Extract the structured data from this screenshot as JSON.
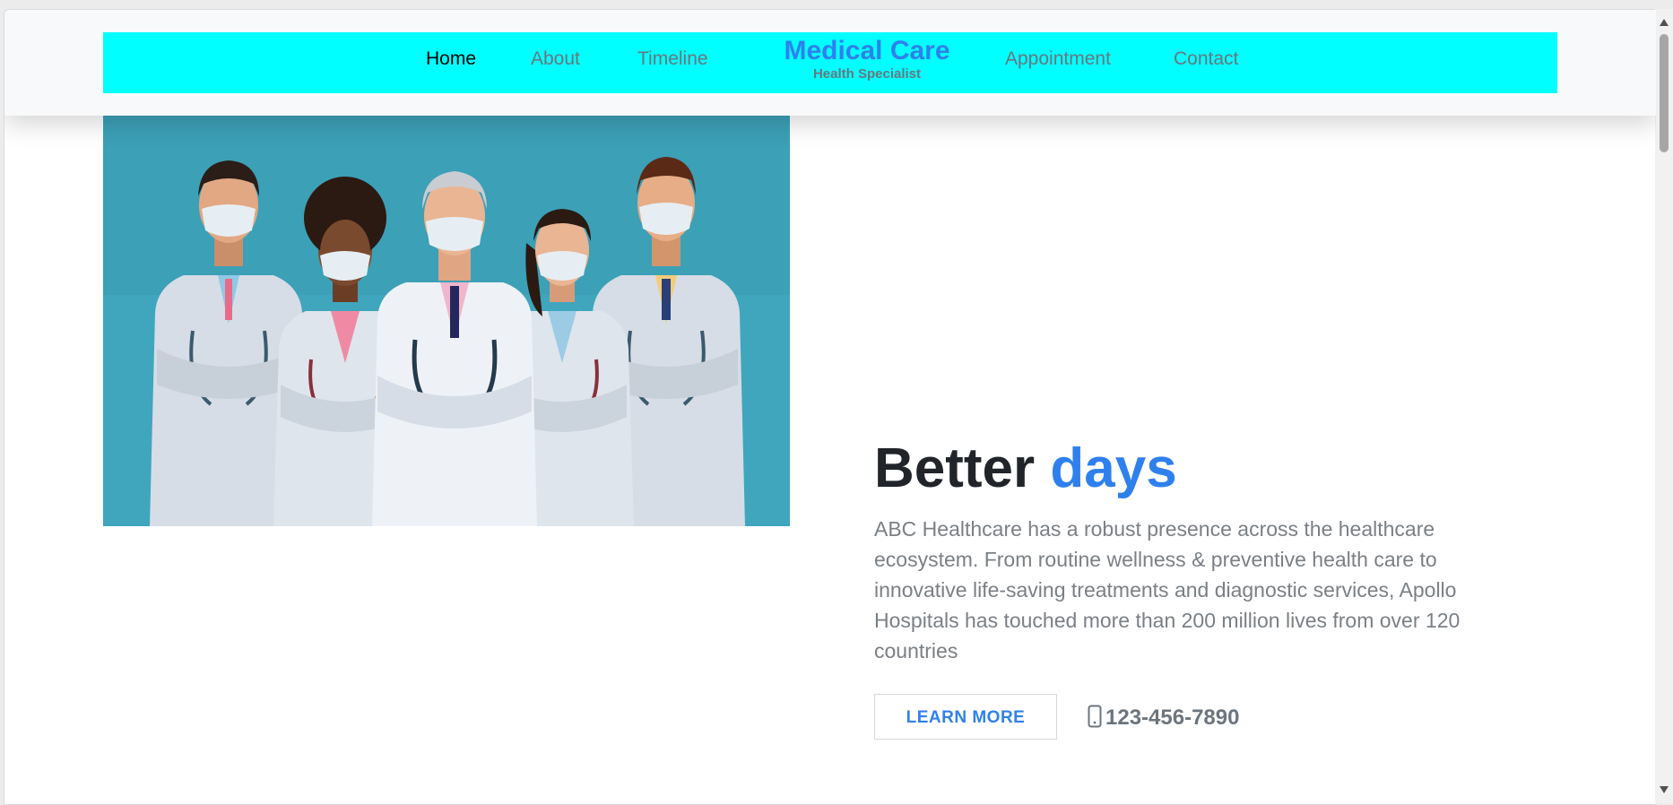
{
  "nav": {
    "links": [
      {
        "label": "Home",
        "active": true
      },
      {
        "label": "About",
        "active": false
      },
      {
        "label": "Timeline",
        "active": false
      },
      {
        "label": "Appointment",
        "active": false
      },
      {
        "label": "Contact",
        "active": false
      }
    ],
    "brand": {
      "title": "Medical Care",
      "subtitle": "Health Specialist"
    }
  },
  "hero": {
    "title_part1": "Better",
    "title_part2": "days",
    "description": "ABC Healthcare has a robust presence across the healthcare ecosystem. From routine wellness & preventive health care to innovative life-saving treatments and diagnostic services, Apollo Hospitals has touched more than 200 million lives from over 120 countries",
    "button_label": "LEARN MORE",
    "phone": "123-456-7890"
  },
  "colors": {
    "nav_background": "#00ffff",
    "accent": "#2f80ed",
    "image_background": "#3fa6bd"
  },
  "icons": {
    "phone": "mobile-phone-icon",
    "scroll_up": "caret-up-icon",
    "scroll_down": "caret-down-icon"
  }
}
